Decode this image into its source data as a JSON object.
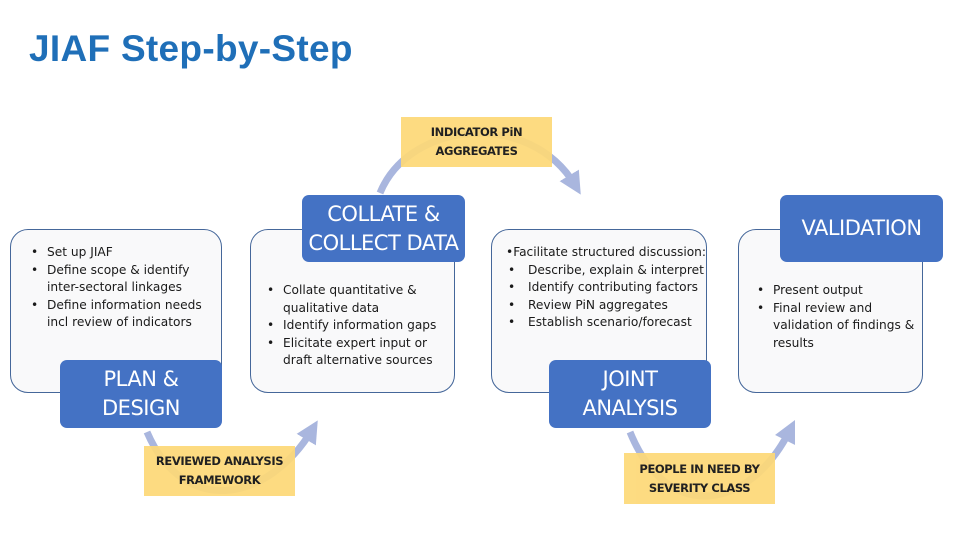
{
  "title": "JIAF Step-by-Step",
  "colors": {
    "title": "#1f6fb8",
    "step_header": "#4472c4",
    "output_box": "#fdd978",
    "panel_border": "#45679a",
    "arrow": "#a9b6de"
  },
  "steps": [
    {
      "header": "PLAN &\nDESIGN",
      "bullets": [
        "Set up JIAF",
        "Define scope & identify inter-sectoral linkages",
        "Define information needs incl review of indicators"
      ]
    },
    {
      "header": "COLLATE &\nCOLLECT DATA",
      "bullets": [
        "Collate quantitative & qualitative data",
        "Identify information gaps",
        "Elicitate expert input or draft alternative sources"
      ]
    },
    {
      "header": "JOINT\nANALYSIS",
      "lead": "•Facilitate structured discussion:",
      "bullets": [
        "Describe, explain & interpret",
        "Identify contributing factors",
        "Review PiN aggregates",
        "Establish scenario/forecast"
      ]
    },
    {
      "header": "VALIDATION",
      "bullets": [
        "Present output",
        "Final review and validation of findings & results"
      ]
    }
  ],
  "outputs": [
    {
      "label": "REVIEWED ANALYSIS\nFRAMEWORK"
    },
    {
      "label": "INDICATOR PiN\nAGGREGATES"
    },
    {
      "label": "PEOPLE IN NEED BY\nSEVERITY CLASS"
    }
  ]
}
